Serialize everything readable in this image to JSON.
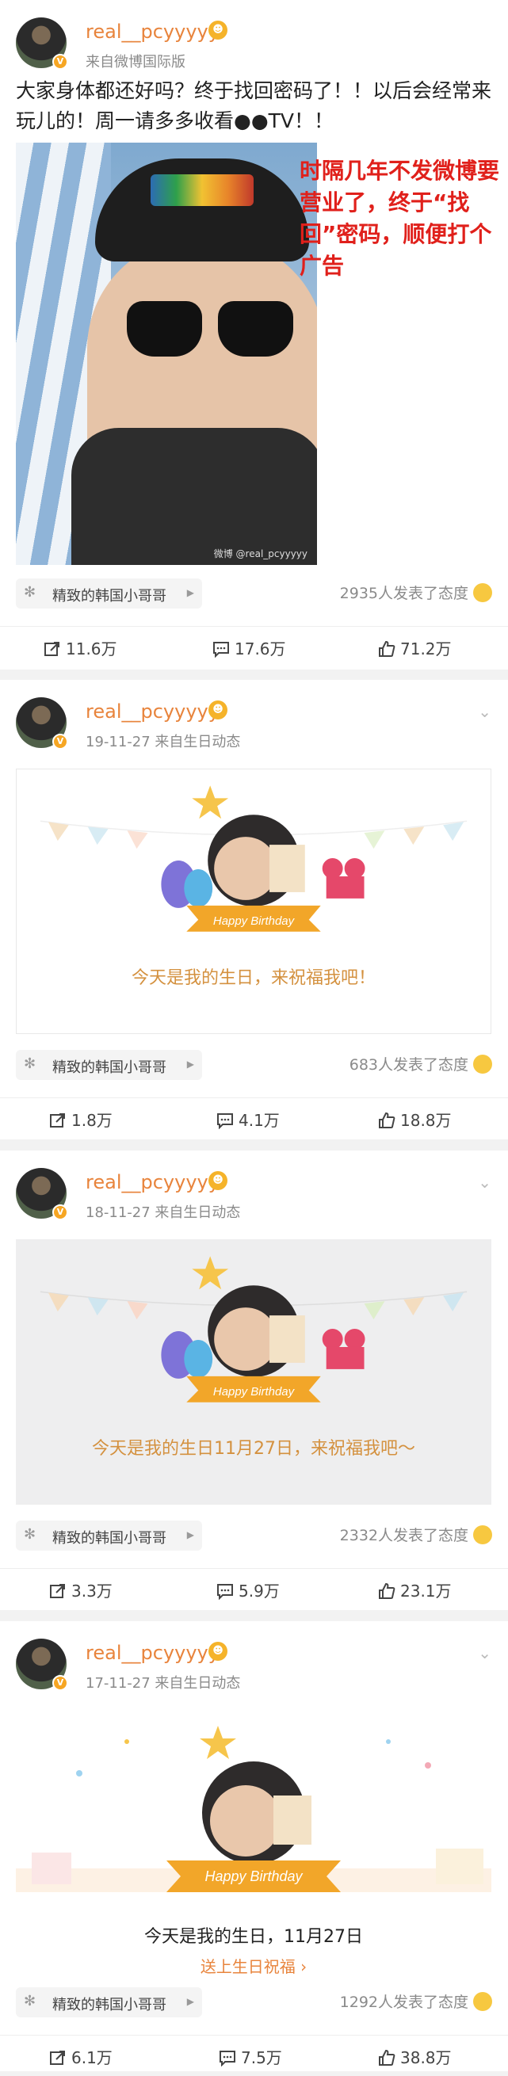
{
  "posts": [
    {
      "username": "real__pcyyyyy",
      "meta": "来自微博国际版",
      "text": "大家身体都还好吗？终于找回密码了！！以后会经常来玩儿的！周一请多多收看●●TV！！",
      "overlay": "时隔几年不发微博要营业了，终于“找回”密码，顺便打个广告",
      "watermark": "微博 @real_pcyyyyy",
      "supertopic": "精致的韩国小哥哥",
      "attitude": "2935人发表了态度",
      "reposts": "11.6万",
      "comments": "17.6万",
      "likes": "71.2万"
    },
    {
      "username": "real__pcyyyyy",
      "meta": "19-11-27  来自生日动态",
      "card_label": "Happy Birthday",
      "card_text": "今天是我的生日，来祝福我吧！",
      "supertopic": "精致的韩国小哥哥",
      "attitude": "683人发表了态度",
      "reposts": "1.8万",
      "comments": "4.1万",
      "likes": "18.8万"
    },
    {
      "username": "real__pcyyyyy",
      "meta": "18-11-27  来自生日动态",
      "card_label": "Happy Birthday",
      "card_text": "今天是我的生日11月27日，来祝福我吧～",
      "supertopic": "精致的韩国小哥哥",
      "attitude": "2332人发表了态度",
      "reposts": "3.3万",
      "comments": "5.9万",
      "likes": "23.1万"
    },
    {
      "username": "real__pcyyyyy",
      "meta": "17-11-27  来自生日动态",
      "card_label": "Happy Birthday",
      "card_text": "今天是我的生日，11月27日",
      "card_link": "送上生日祝福 ›",
      "supertopic": "精致的韩国小哥哥",
      "attitude": "1292人发表了态度",
      "reposts": "6.1万",
      "comments": "7.5万",
      "likes": "38.8万"
    }
  ],
  "colors": {
    "username": "#e8843c",
    "overlay": "#e0201b",
    "card_text": "#d4913f"
  },
  "icons": [
    "avatar-verified-icon",
    "vip-face-icon",
    "supertopic-icon",
    "repost-icon",
    "comment-icon",
    "like-icon",
    "chevron-down-icon",
    "smile-emoji-icon"
  ]
}
